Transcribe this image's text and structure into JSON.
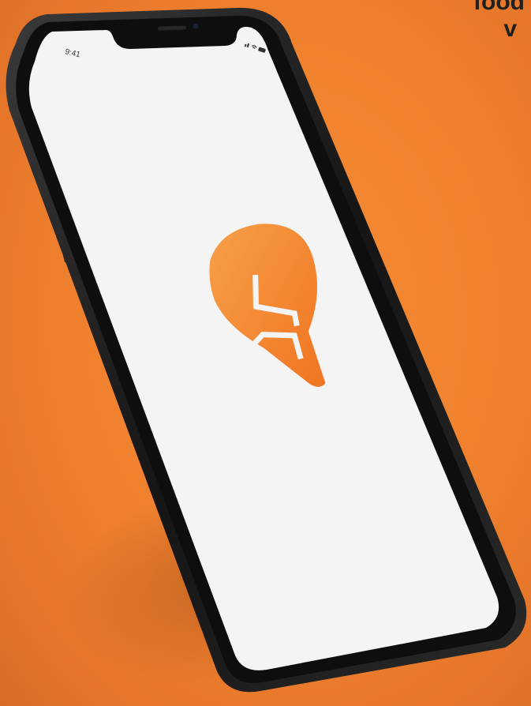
{
  "header": {
    "text_line1": "food",
    "text_line2": "v"
  },
  "status_bar": {
    "time": "9:41",
    "icons": [
      "signal-icon",
      "wifi-icon",
      "battery-icon"
    ]
  },
  "app": {
    "logo": "swiggy-logo",
    "brand_color": "#f07e2a",
    "screen_color": "#f4f4f4"
  },
  "colors": {
    "background": "#f08535",
    "phone_frame": "#1a1a1a"
  }
}
